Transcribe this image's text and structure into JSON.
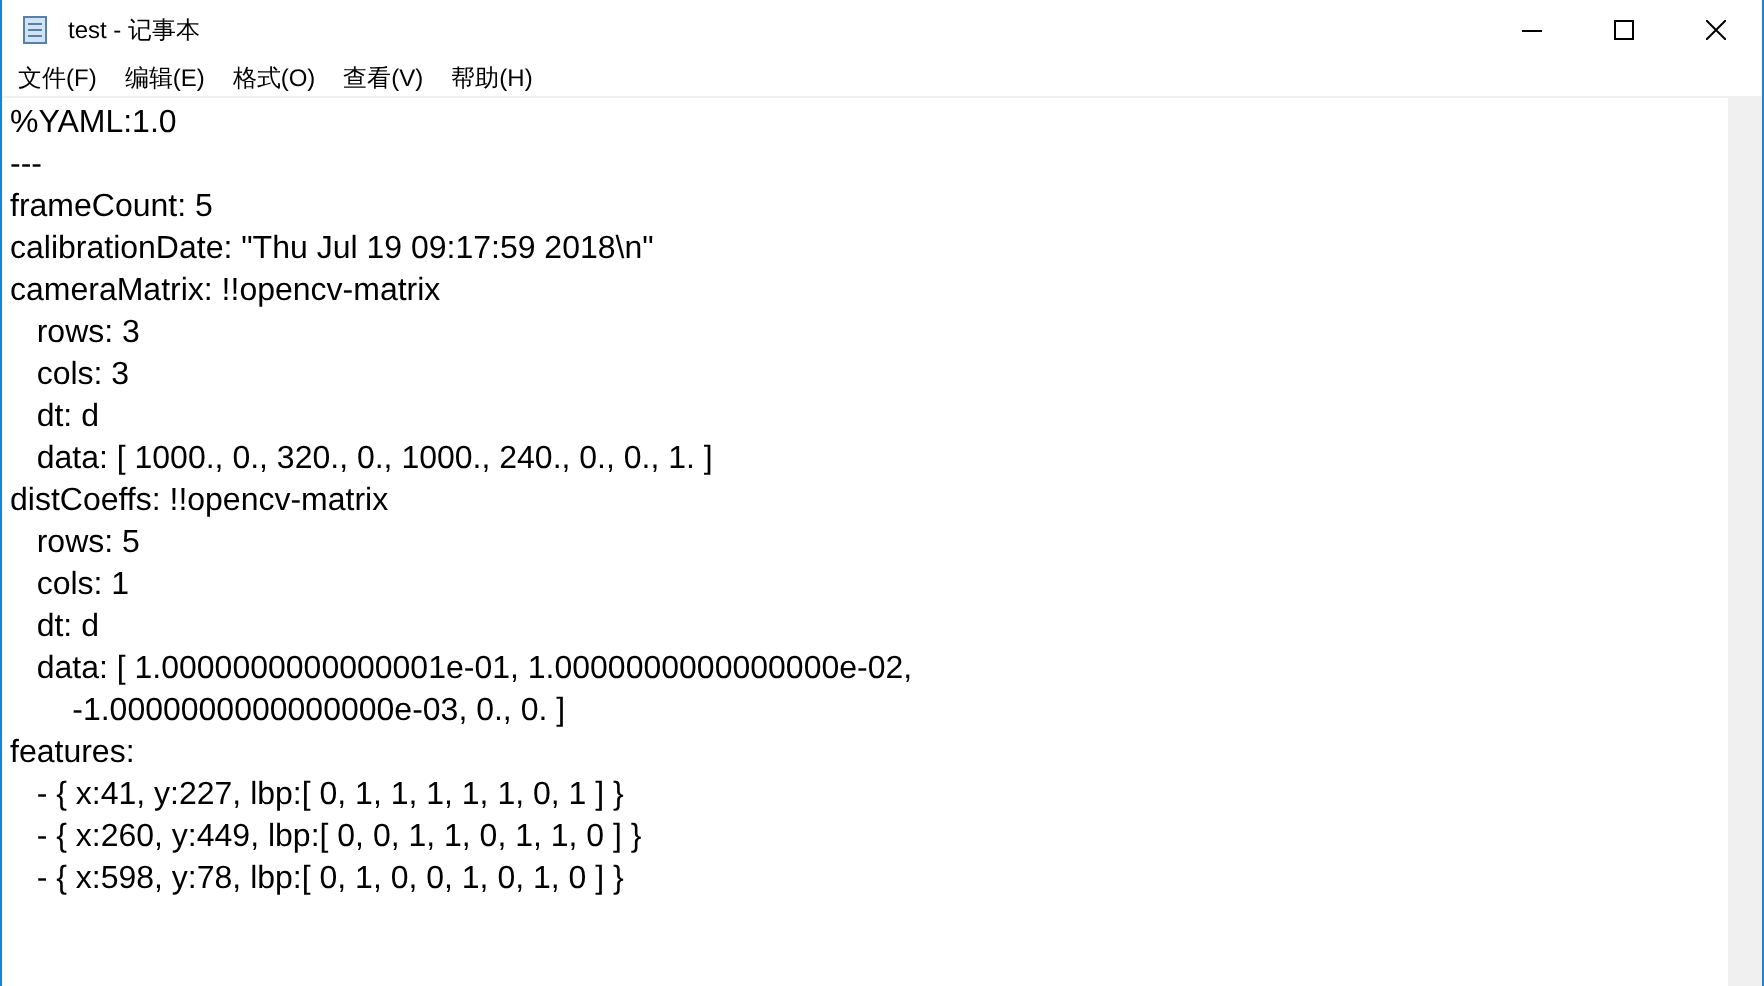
{
  "window": {
    "title": "test - 记事本"
  },
  "menu": [
    "文件(F)",
    "编辑(E)",
    "格式(O)",
    "查看(V)",
    "帮助(H)"
  ],
  "editor": {
    "lines": [
      "%YAML:1.0",
      "---",
      "frameCount: 5",
      "calibrationDate: \"Thu Jul 19 09:17:59 2018\\n\"",
      "cameraMatrix: !!opencv-matrix",
      "   rows: 3",
      "   cols: 3",
      "   dt: d",
      "   data: [ 1000., 0., 320., 0., 1000., 240., 0., 0., 1. ]",
      "distCoeffs: !!opencv-matrix",
      "   rows: 5",
      "   cols: 1",
      "   dt: d",
      "   data: [ 1.0000000000000001e-01, 1.0000000000000000e-02,",
      "       -1.0000000000000000e-03, 0., 0. ]",
      "features:",
      "   - { x:41, y:227, lbp:[ 0, 1, 1, 1, 1, 1, 0, 1 ] }",
      "   - { x:260, y:449, lbp:[ 0, 0, 1, 1, 0, 1, 1, 0 ] }",
      "   - { x:598, y:78, lbp:[ 0, 1, 0, 0, 1, 0, 1, 0 ] }"
    ]
  }
}
